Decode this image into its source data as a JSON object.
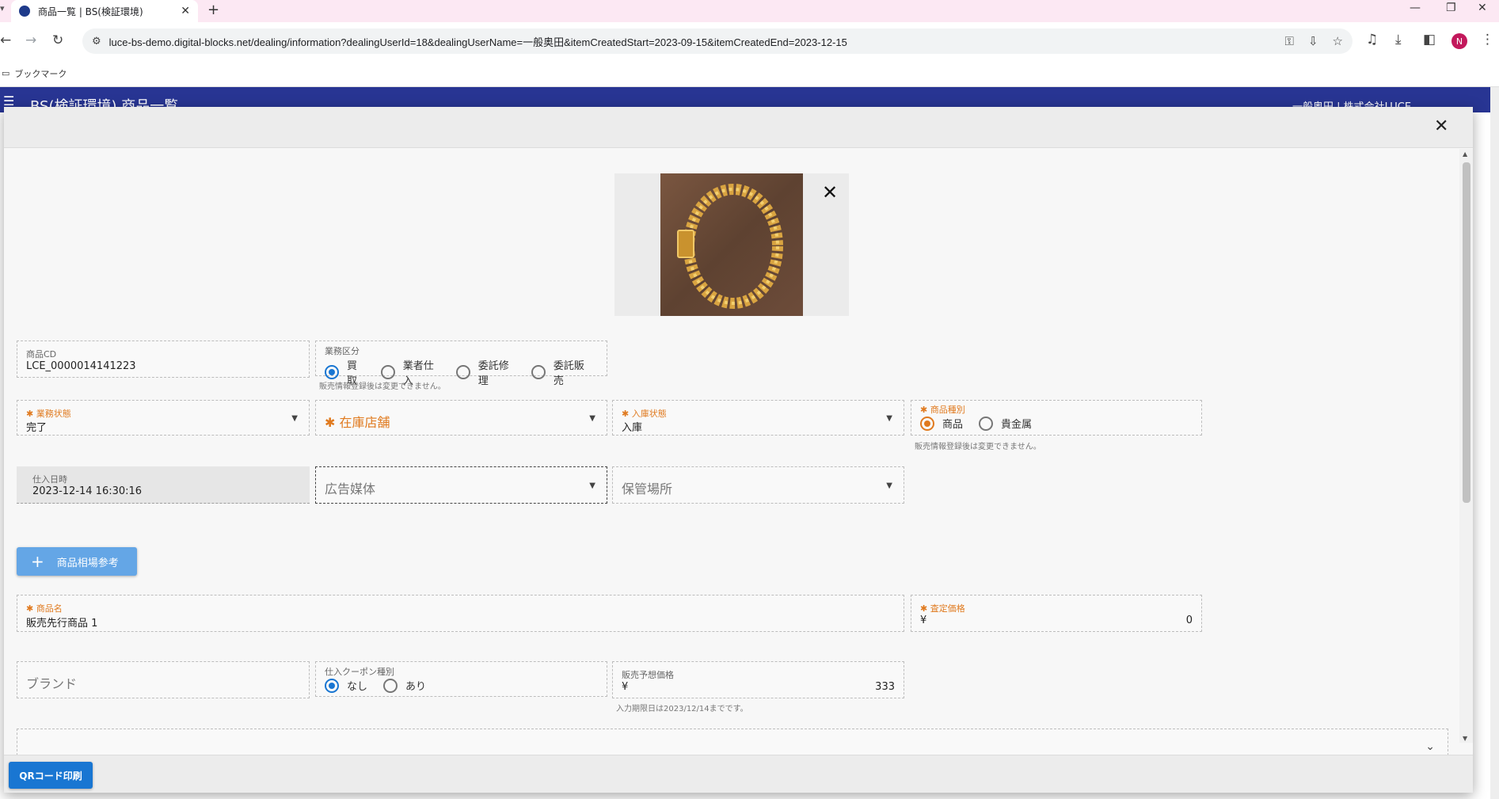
{
  "browser": {
    "tab_title": "商品一覧 | BS(検証環境)",
    "url": "luce-bs-demo.digital-blocks.net/dealing/information?dealingUserId=18&dealingUserName=一般奥田&itemCreatedStart=2023-09-15&itemCreatedEnd=2023-12-15",
    "bookmarks_label": "ブックマーク",
    "profile_initial": "N"
  },
  "app": {
    "title": "BS(検証環境) 商品一覧",
    "user": "一般奥田 | 株式会社LUCE"
  },
  "dialog": {
    "item_cd": {
      "label": "商品CD",
      "value": "LCE_0000014141223"
    },
    "business_type": {
      "label": "業務区分",
      "options": [
        "買取",
        "業者仕入",
        "委託修理",
        "委託販売"
      ],
      "selected": "買取",
      "hint": "販売情報登録後は変更できません。"
    },
    "business_status": {
      "label": "業務状態",
      "value": "完了"
    },
    "stock_store": {
      "placeholder": "在庫店舗"
    },
    "stock_status": {
      "label": "入庫状態",
      "value": "入庫"
    },
    "item_kind": {
      "label": "商品種別",
      "options": [
        "商品",
        "貴金属"
      ],
      "selected": "商品",
      "hint": "販売情報登録後は変更できません。"
    },
    "purchase_date": {
      "label": "仕入日時",
      "value": "2023-12-14 16:30:16"
    },
    "ad_media": {
      "placeholder": "広告媒体"
    },
    "storage": {
      "placeholder": "保管場所"
    },
    "market_button_label": "商品相場参考",
    "item_name": {
      "label": "商品名",
      "value": "販売先行商品 1"
    },
    "assessed_price": {
      "label": "査定価格",
      "currency": "¥",
      "value": "0"
    },
    "brand": {
      "placeholder": "ブランド"
    },
    "coupon_type": {
      "label": "仕入クーポン種別",
      "options": [
        "なし",
        "あり"
      ],
      "selected": "なし"
    },
    "expected_price": {
      "label": "販売予想価格",
      "currency": "¥",
      "value": "333",
      "hint": "入力期限日は2023/12/14までです。"
    },
    "qr_button_label": "QRコード印刷"
  },
  "colors": {
    "app_bar": "#283593",
    "primary": "#1976d2",
    "required": "#e07a1f",
    "secondary_button": "#64a6e6"
  }
}
